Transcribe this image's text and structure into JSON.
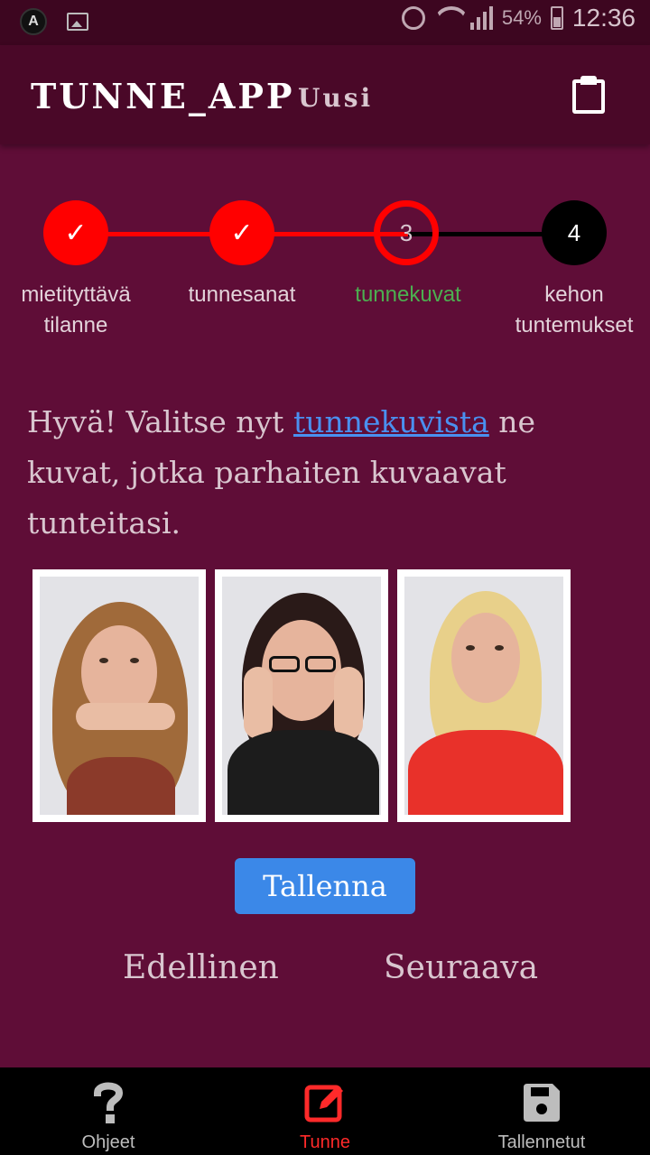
{
  "status_bar": {
    "battery": "54%",
    "time": "12:36"
  },
  "app_bar": {
    "title": "TUNNE_APP",
    "subtitle": "Uusi",
    "action_icon": "clipboard-icon"
  },
  "stepper": {
    "steps": [
      {
        "marker": "✓",
        "label": "mietityttävä tilanne",
        "state": "done"
      },
      {
        "marker": "✓",
        "label": "tunnesanat",
        "state": "done"
      },
      {
        "marker": "3",
        "label": "tunnekuvat",
        "state": "active"
      },
      {
        "marker": "4",
        "label": "kehon tuntemukset",
        "state": "todo"
      }
    ],
    "colors": {
      "done": "#ff0000",
      "active_label": "#4caf50",
      "todo": "#000000"
    }
  },
  "message": {
    "before_link": "Hyvä! Valitse nyt ",
    "link": "tunnekuvista",
    "after_link": " ne kuvat, jotka parhaiten kuvaavat tunteitasi."
  },
  "photos": [
    {
      "name": "thinking-woman-photo"
    },
    {
      "name": "shocked-woman-photo"
    },
    {
      "name": "surprised-woman-photo"
    }
  ],
  "actions": {
    "save": "Tallenna",
    "previous": "Edellinen",
    "next": "Seuraava"
  },
  "bottom_nav": {
    "items": [
      {
        "label": "Ohjeet",
        "icon": "question-icon",
        "active": false
      },
      {
        "label": "Tunne",
        "icon": "edit-icon",
        "active": true
      },
      {
        "label": "Tallennetut",
        "icon": "save-icon",
        "active": false
      }
    ],
    "active_color": "#ff2a2a"
  }
}
